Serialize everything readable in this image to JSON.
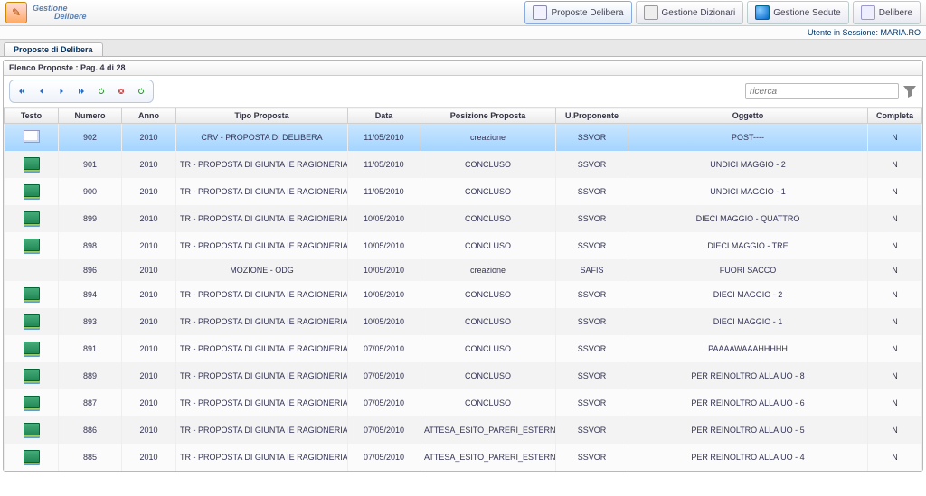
{
  "app": {
    "brand_line1": "Gestione",
    "brand_line2": "Delibere"
  },
  "nav_buttons": {
    "proposte": "Proposte Delibera",
    "dizionari": "Gestione Dizionari",
    "sedute": "Gestione Sedute",
    "delibere": "Delibere"
  },
  "session": {
    "label": "Utente in Sessione: MARIA.RO"
  },
  "tab": {
    "label": "Proposte di Delibera"
  },
  "panel": {
    "title": "Elenco Proposte : Pag. 4 di 28"
  },
  "search": {
    "placeholder": "ricerca"
  },
  "columns": {
    "testo": "Testo",
    "numero": "Numero",
    "anno": "Anno",
    "tipo": "Tipo Proposta",
    "data": "Data",
    "posizione": "Posizione Proposta",
    "proponente": "U.Proponente",
    "oggetto": "Oggetto",
    "completa": "Completa"
  },
  "rows": [
    {
      "icon": "doc",
      "numero": "902",
      "anno": "2010",
      "tipo": "CRV - PROPOSTA DI DELIBERA",
      "data": "11/05/2010",
      "posizione": "creazione",
      "proponente": "SSVOR",
      "oggetto": "POST----",
      "completa": "N",
      "sel": true
    },
    {
      "icon": "book",
      "numero": "901",
      "anno": "2010",
      "tipo": "TR - PROPOSTA DI GIUNTA IE RAGIONERIA",
      "data": "11/05/2010",
      "posizione": "CONCLUSO",
      "proponente": "SSVOR",
      "oggetto": "UNDICI MAGGIO - 2",
      "completa": "N"
    },
    {
      "icon": "book",
      "numero": "900",
      "anno": "2010",
      "tipo": "TR - PROPOSTA DI GIUNTA IE RAGIONERIA",
      "data": "11/05/2010",
      "posizione": "CONCLUSO",
      "proponente": "SSVOR",
      "oggetto": "UNDICI MAGGIO - 1",
      "completa": "N"
    },
    {
      "icon": "book",
      "numero": "899",
      "anno": "2010",
      "tipo": "TR - PROPOSTA DI GIUNTA IE RAGIONERIA",
      "data": "10/05/2010",
      "posizione": "CONCLUSO",
      "proponente": "SSVOR",
      "oggetto": "DIECI MAGGIO - QUATTRO",
      "completa": "N"
    },
    {
      "icon": "book",
      "numero": "898",
      "anno": "2010",
      "tipo": "TR - PROPOSTA DI GIUNTA IE RAGIONERIA",
      "data": "10/05/2010",
      "posizione": "CONCLUSO",
      "proponente": "SSVOR",
      "oggetto": "DIECI MAGGIO - TRE",
      "completa": "N"
    },
    {
      "icon": "",
      "numero": "896",
      "anno": "2010",
      "tipo": "MOZIONE - ODG",
      "data": "10/05/2010",
      "posizione": "creazione",
      "proponente": "SAFIS",
      "oggetto": "FUORI SACCO",
      "completa": "N"
    },
    {
      "icon": "book",
      "numero": "894",
      "anno": "2010",
      "tipo": "TR - PROPOSTA DI GIUNTA IE RAGIONERIA",
      "data": "10/05/2010",
      "posizione": "CONCLUSO",
      "proponente": "SSVOR",
      "oggetto": "DIECI MAGGIO - 2",
      "completa": "N"
    },
    {
      "icon": "book",
      "numero": "893",
      "anno": "2010",
      "tipo": "TR - PROPOSTA DI GIUNTA IE RAGIONERIA",
      "data": "10/05/2010",
      "posizione": "CONCLUSO",
      "proponente": "SSVOR",
      "oggetto": "DIECI MAGGIO - 1",
      "completa": "N"
    },
    {
      "icon": "book",
      "numero": "891",
      "anno": "2010",
      "tipo": "TR - PROPOSTA DI GIUNTA IE RAGIONERIA",
      "data": "07/05/2010",
      "posizione": "CONCLUSO",
      "proponente": "SSVOR",
      "oggetto": "PAAAAWAAAHHHHH",
      "completa": "N"
    },
    {
      "icon": "book",
      "numero": "889",
      "anno": "2010",
      "tipo": "TR - PROPOSTA DI GIUNTA IE RAGIONERIA",
      "data": "07/05/2010",
      "posizione": "CONCLUSO",
      "proponente": "SSVOR",
      "oggetto": "PER REINOLTRO ALLA UO - 8",
      "completa": "N"
    },
    {
      "icon": "book",
      "numero": "887",
      "anno": "2010",
      "tipo": "TR - PROPOSTA DI GIUNTA IE RAGIONERIA",
      "data": "07/05/2010",
      "posizione": "CONCLUSO",
      "proponente": "SSVOR",
      "oggetto": "PER REINOLTRO ALLA UO - 6",
      "completa": "N"
    },
    {
      "icon": "book",
      "numero": "886",
      "anno": "2010",
      "tipo": "TR - PROPOSTA DI GIUNTA IE RAGIONERIA",
      "data": "07/05/2010",
      "posizione": "ATTESA_ESITO_PARERI_ESTERNI",
      "proponente": "SSVOR",
      "oggetto": "PER REINOLTRO ALLA UO - 5",
      "completa": "N"
    },
    {
      "icon": "book",
      "numero": "885",
      "anno": "2010",
      "tipo": "TR - PROPOSTA DI GIUNTA IE RAGIONERIA",
      "data": "07/05/2010",
      "posizione": "ATTESA_ESITO_PARERI_ESTERNI",
      "proponente": "SSVOR",
      "oggetto": "PER REINOLTRO ALLA UO - 4",
      "completa": "N"
    }
  ]
}
